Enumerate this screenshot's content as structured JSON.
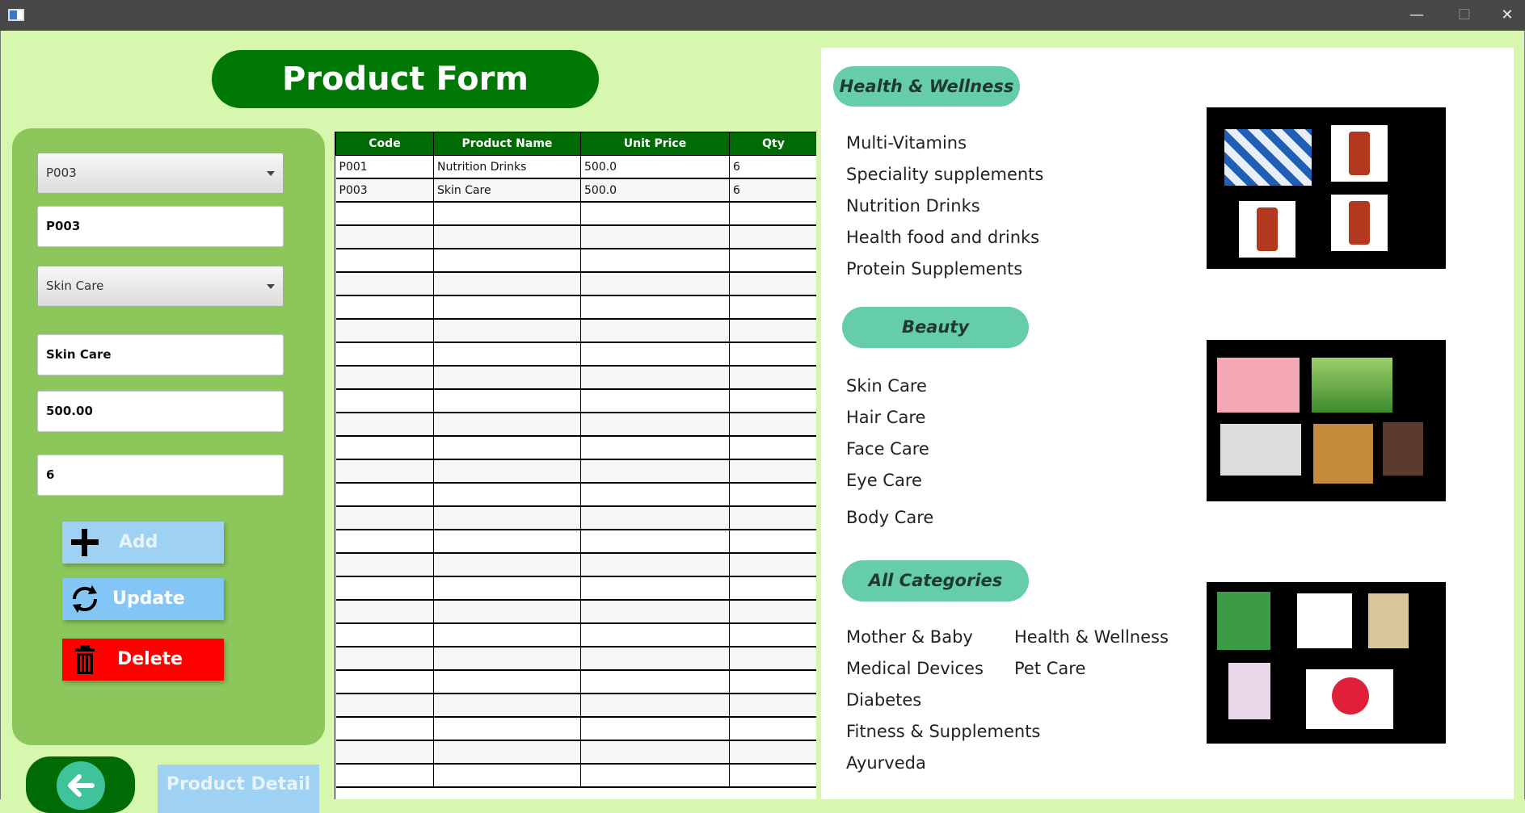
{
  "window": {
    "minimize": "—",
    "maximize": "☐",
    "close": "✕"
  },
  "form": {
    "title": "Product Form",
    "code_combo": "P003",
    "code_field": "P003",
    "name_combo": "Skin Care",
    "name_field": "Skin Care",
    "price_field": "500.00",
    "qty_field": "6",
    "add_label": "Add",
    "update_label": "Update",
    "delete_label": "Delete",
    "product_detail_label": "Product Detail"
  },
  "table": {
    "columns": [
      "Code",
      "Product Name",
      "Unit Price",
      "Qty"
    ],
    "rows": [
      [
        "P001",
        "Nutrition Drinks",
        "500.0",
        "6"
      ],
      [
        "P003",
        "Skin Care",
        "500.0",
        "6"
      ]
    ]
  },
  "categories": {
    "health": {
      "title": "Health & Wellness",
      "items": [
        "Multi-Vitamins",
        "Speciality supplements",
        "Nutrition Drinks",
        "Health food and drinks",
        "Protein Supplements"
      ]
    },
    "beauty": {
      "title": "Beauty",
      "items": [
        "Skin Care",
        "Hair Care",
        "Face Care",
        "Eye Care",
        "Body Care"
      ]
    },
    "all": {
      "title": "All Categories",
      "col1": [
        "Mother & Baby",
        "Medical Devices",
        "Diabetes",
        "Fitness & Supplements",
        "Ayurveda"
      ],
      "col2": [
        "Health & Wellness",
        "Pet Care"
      ]
    }
  },
  "colors": {
    "background": "#d6f7ad",
    "panel": "#8cc75c",
    "header": "#007806",
    "pill": "#66cdaa",
    "add": "#9fd1f3",
    "update": "#83c6f6",
    "delete": "#ff0000"
  },
  "icons": {
    "add": "plus-icon",
    "update": "refresh-icon",
    "delete": "trash-icon",
    "back": "arrow-left-icon"
  }
}
